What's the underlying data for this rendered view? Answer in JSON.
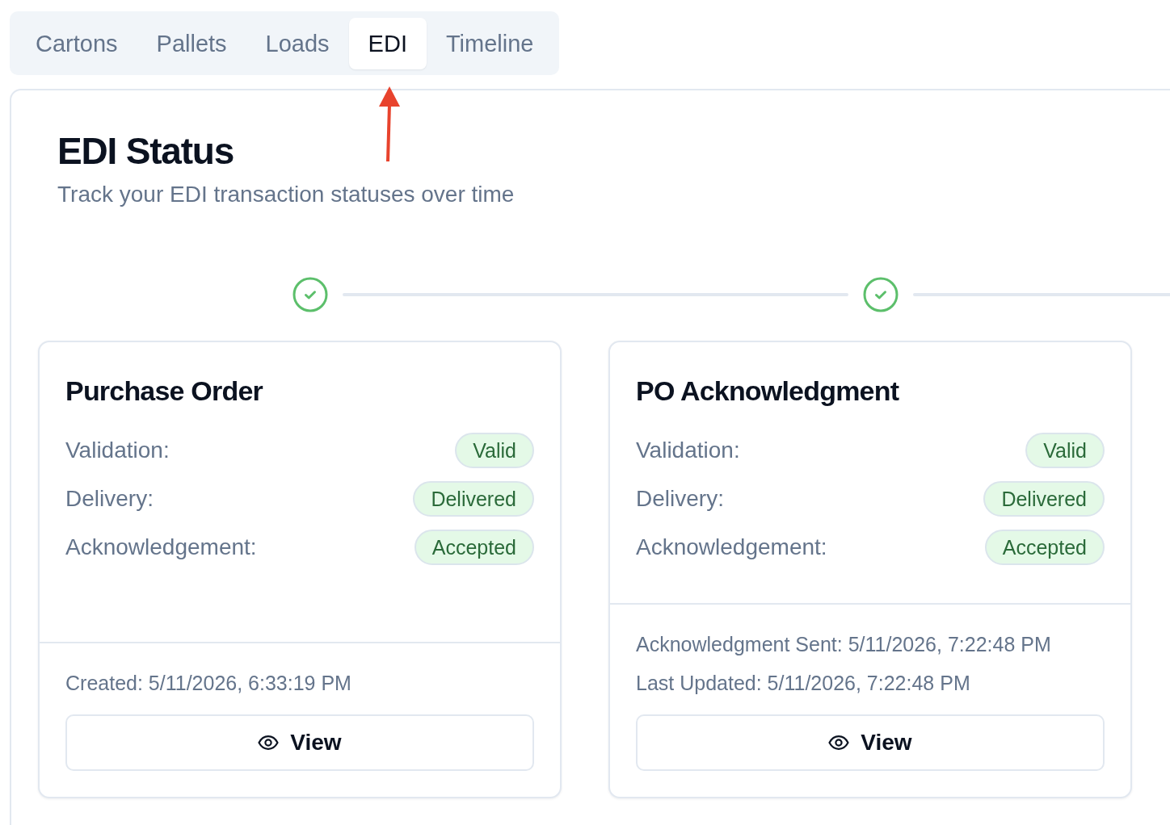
{
  "tabs": [
    {
      "label": "Cartons",
      "selected": false
    },
    {
      "label": "Pallets",
      "selected": false
    },
    {
      "label": "Loads",
      "selected": false
    },
    {
      "label": "EDI",
      "selected": true
    },
    {
      "label": "Timeline",
      "selected": false
    }
  ],
  "annotation": {
    "kind": "arrow"
  },
  "header": {
    "title": "EDI Status",
    "subtitle": "Track your EDI transaction statuses over time"
  },
  "transactions": [
    {
      "completed": true,
      "title": "Purchase Order",
      "statuses": [
        {
          "label": "Validation:",
          "value": "Valid"
        },
        {
          "label": "Delivery:",
          "value": "Delivered"
        },
        {
          "label": "Acknowledgement:",
          "value": "Accepted"
        }
      ],
      "footer_lines": [
        "Created: 5/11/2026, 6:33:19 PM"
      ],
      "button": "View"
    },
    {
      "completed": true,
      "title": "PO Acknowledgment",
      "statuses": [
        {
          "label": "Validation:",
          "value": "Valid"
        },
        {
          "label": "Delivery:",
          "value": "Delivered"
        },
        {
          "label": "Acknowledgement:",
          "value": "Accepted"
        }
      ],
      "footer_lines": [
        "Acknowledgment Sent: 5/11/2026, 7:22:48 PM",
        "Last Updated: 5/11/2026, 7:22:48 PM"
      ],
      "button": "View"
    }
  ]
}
